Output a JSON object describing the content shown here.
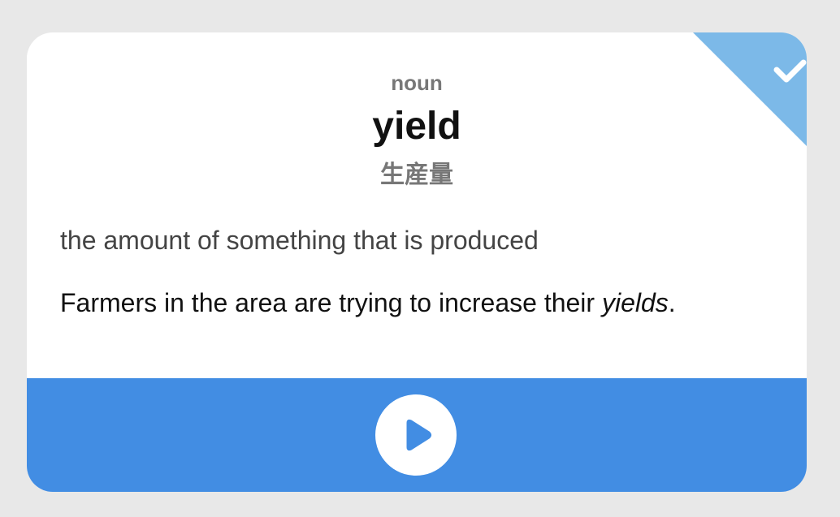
{
  "card": {
    "part_of_speech": "noun",
    "word": "yield",
    "translation": "生産量",
    "definition": "the amount of something that is produced",
    "example": {
      "before": "Farmers in the area are trying to increase their ",
      "highlight": "yields",
      "after": "."
    },
    "known_marker_icon": "checkmark-icon",
    "play_icon": "play-icon"
  },
  "colors": {
    "background": "#e8e8e8",
    "card": "#ffffff",
    "accent_blue": "#428de3",
    "corner_blue": "#7cb9e8",
    "muted_text": "#777777"
  }
}
